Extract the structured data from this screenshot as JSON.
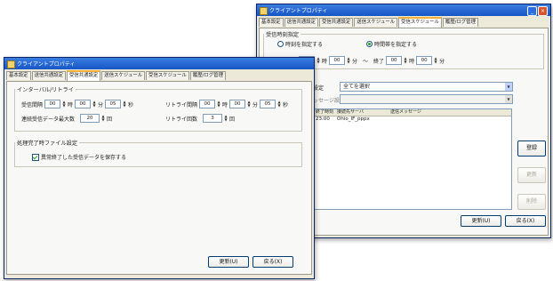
{
  "back_window": {
    "title": "クライアントプロパティ",
    "tabs": [
      "基本設定",
      "送信共通設定",
      "受信共通設定",
      "送信スケジュール",
      "受信スケジュール",
      "履歴/ログ管理"
    ],
    "active_tab": 4,
    "group_time": {
      "legend": "受信時刻指定",
      "radio1": "時刻を指定する",
      "radio2": "時間帯を指定する",
      "h1": "00",
      "h_unit1": "時",
      "m1": "00",
      "m_unit1": "分",
      "sep": "～",
      "end_label": "終了",
      "h2": "00",
      "h_unit2": "時",
      "m2": "00",
      "m_unit2": "分"
    },
    "select1_label": "設定",
    "select1_value": "全てを選択",
    "select2_label": "ッセージ設定",
    "list": {
      "headers": [
        "終了時刻",
        "接続先サーバ",
        "送信メッセージ"
      ],
      "rows": [
        [
          "23:00",
          "Ohio_IF_pppx",
          ""
        ]
      ]
    },
    "buttons": {
      "register": "登録",
      "update": "更新",
      "delete": "削除",
      "update_bottom": "更新(U)",
      "return": "戻る(X)"
    }
  },
  "front_window": {
    "title": "クライアントプロパティ",
    "tabs": [
      "基本設定",
      "送信共通設定",
      "受信共通設定",
      "送信スケジュール",
      "受信スケジュール",
      "履歴/ログ管理"
    ],
    "active_tab": 2,
    "group_interval": {
      "legend": "インターバル/リトライ",
      "recv_interval_label": "受信間隔",
      "ri_h": "00",
      "ri_h_unit": "時",
      "ri_m": "00",
      "ri_m_unit": "分",
      "ri_s": "05",
      "ri_s_unit": "秒",
      "retry_interval_label": "リトライ間隔",
      "rt_h": "00",
      "rt_h_unit": "時",
      "rt_m": "00",
      "rt_m_unit": "分",
      "rt_s": "05",
      "rt_s_unit": "秒",
      "max_count_label": "連続受信データ最大数",
      "max_count": "20",
      "max_count_unit": "回",
      "retry_count_label": "リトライ回数",
      "retry_count": "3",
      "retry_count_unit": "回"
    },
    "group_file": {
      "legend": "処理完了時ファイル設定",
      "checkbox_label": "異常終了した受信データを保存する"
    },
    "buttons": {
      "update": "更新(U)",
      "return": "戻る(X)"
    }
  }
}
